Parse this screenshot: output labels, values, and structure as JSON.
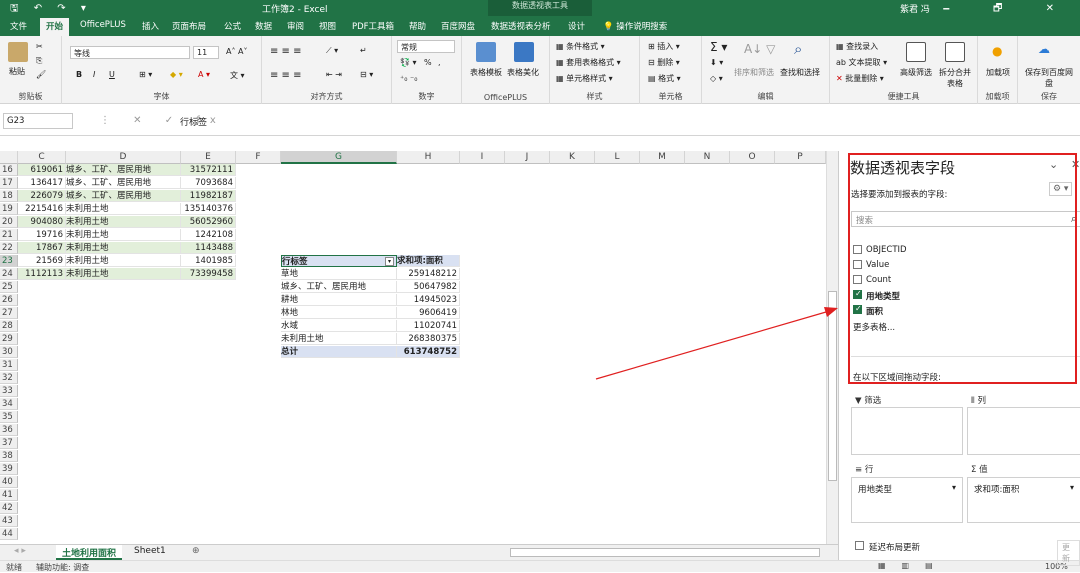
{
  "app": {
    "title": "工作簿2 - Excel",
    "context_tab_group": "数据透视表工具",
    "user": "紫君 冯",
    "quick_access": "🖫 ↶ ↷ ▾",
    "window_controls": "🗕 🗗 ✕",
    "tell_me": "操作说明搜索"
  },
  "tabs": [
    "文件",
    "开始",
    "OfficePLUS",
    "插入",
    "页面布局",
    "公式",
    "数据",
    "审阅",
    "视图",
    "PDF工具箱",
    "帮助",
    "百度网盘",
    "数据透视表分析",
    "设计"
  ],
  "ribbon": {
    "clipboard": {
      "paste": "粘贴",
      "label": "剪贴板"
    },
    "font": {
      "name": "等线",
      "size": "11",
      "label": "字体",
      "bold": "B",
      "italic": "I",
      "underline": "U"
    },
    "align": {
      "label": "对齐方式"
    },
    "number": {
      "format": "常规",
      "label": "数字",
      "percent": "%",
      "comma": ","
    },
    "officeplus": {
      "b1": "表格模板",
      "b2": "表格美化",
      "label": "OfficePLUS"
    },
    "styles": {
      "b1": "条件格式",
      "b2": "套用表格格式",
      "b3": "单元格样式",
      "label": "样式"
    },
    "cells": {
      "b1": "插入",
      "b2": "删除",
      "b3": "格式",
      "label": "单元格"
    },
    "editing": {
      "b1": "排序和筛选",
      "b2": "查找和选择",
      "label": "编辑"
    },
    "tools": {
      "b1": "查找录入",
      "b2": "文本提取",
      "b3": "批量删除",
      "b4": "高级筛选",
      "b5": "拆分合并表格",
      "label": "便捷工具"
    },
    "addins": {
      "b1": "加载项",
      "label": "加载项"
    },
    "save": {
      "b1": "保存到百度网盘",
      "label": "保存"
    }
  },
  "formula_bar": {
    "name_box": "G23",
    "value": "行标签"
  },
  "columns": [
    "C",
    "D",
    "E",
    "F",
    "G",
    "H",
    "I",
    "J",
    "K",
    "L",
    "M",
    "N",
    "O",
    "P"
  ],
  "rows": [
    "16",
    "17",
    "18",
    "19",
    "20",
    "21",
    "22",
    "23",
    "24",
    "25",
    "26",
    "27",
    "28",
    "29",
    "30",
    "31",
    "32",
    "33",
    "34",
    "35",
    "36",
    "37",
    "38",
    "39",
    "40",
    "41",
    "42",
    "43",
    "44"
  ],
  "source_rows": [
    {
      "c": "619061",
      "d": "城乡、工矿、居民用地",
      "e": "31572111"
    },
    {
      "c": "136417",
      "d": "城乡、工矿、居民用地",
      "e": "7093684"
    },
    {
      "c": "226079",
      "d": "城乡、工矿、居民用地",
      "e": "11982187"
    },
    {
      "c": "2215416",
      "d": "未利用土地",
      "e": "135140376"
    },
    {
      "c": "904080",
      "d": "未利用土地",
      "e": "56052960"
    },
    {
      "c": "19716",
      "d": "未利用土地",
      "e": "1242108"
    },
    {
      "c": "17867",
      "d": "未利用土地",
      "e": "1143488"
    },
    {
      "c": "21569",
      "d": "未利用土地",
      "e": "1401985"
    },
    {
      "c": "1112113",
      "d": "未利用土地",
      "e": "73399458"
    }
  ],
  "pivot": {
    "header_label": "行标签",
    "header_value": "求和项:面积",
    "rows": [
      {
        "label": "草地",
        "value": "259148212"
      },
      {
        "label": "城乡、工矿、居民用地",
        "value": "50647982"
      },
      {
        "label": "耕地",
        "value": "14945023"
      },
      {
        "label": "林地",
        "value": "9606419"
      },
      {
        "label": "水域",
        "value": "11020741"
      },
      {
        "label": "未利用土地",
        "value": "268380375"
      }
    ],
    "total_label": "总计",
    "total_value": "613748752"
  },
  "sheets": [
    "土地利用面积",
    "Sheet1"
  ],
  "status": {
    "ready": "就绪",
    "accessibility": "辅助功能: 调查",
    "zoom": "100%"
  },
  "pane": {
    "title": "数据透视表字段",
    "subtitle": "选择要添加到报表的字段:",
    "search_placeholder": "搜索",
    "fields": [
      {
        "name": "OBJECTID",
        "checked": false
      },
      {
        "name": "Value",
        "checked": false
      },
      {
        "name": "Count",
        "checked": false
      },
      {
        "name": "用地类型",
        "checked": true
      },
      {
        "name": "面积",
        "checked": true
      }
    ],
    "more_tables": "更多表格...",
    "drag_hint": "在以下区域间拖动字段:",
    "filters": "筛选",
    "columns": "列",
    "rows": "行",
    "values": "值",
    "row_item": "用地类型",
    "value_item": "求和项:面积",
    "defer": "延迟布局更新",
    "update": "更新"
  },
  "colors": {
    "excel_green": "#217346",
    "annotation_red": "#e02020",
    "pivot_header": "#d9e1f2",
    "band_green": "#e2efda"
  }
}
